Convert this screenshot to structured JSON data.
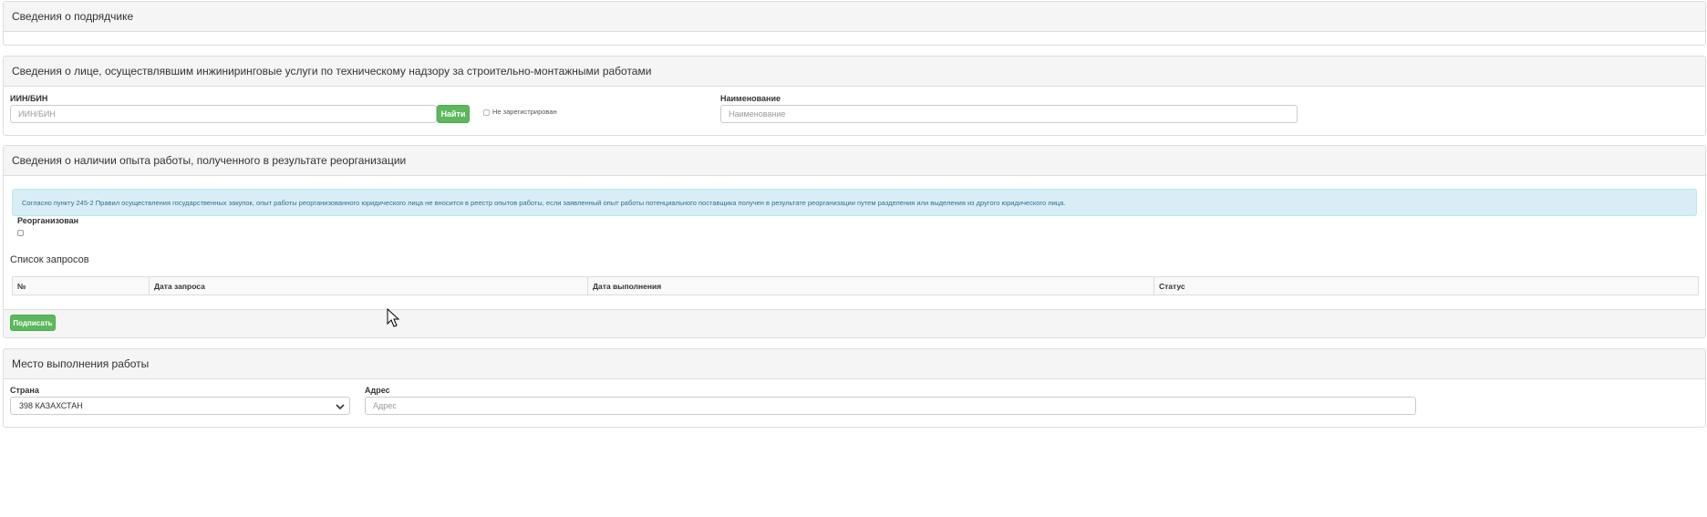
{
  "contractor": {
    "title": "Сведения о подрядчике"
  },
  "engineering": {
    "title": "Сведения о лице, осуществлявшим инжиниринговые услуги по техническому надзору за строительно-монтажными работами",
    "iin_label": "ИИН/БИН",
    "iin_placeholder": "ИИН/БИН",
    "find_button": "Найти",
    "not_registered_label": "Не зарегистрирован",
    "name_label": "Наименование",
    "name_placeholder": "Наименование"
  },
  "reorganization": {
    "title": "Сведения о наличии опыта работы, полученного в результате реорганизации",
    "info_text": "Согласно пункту 245-2 Правил осуществления государственных закупок, опыт работы реорганизованного юридического лица не вносится в реестр опытов работы, если заявленный опыт работы потенциального поставщика получен в результате реорганизации путем разделения или выделения из другого юридического лица.",
    "reorganized_label": "Реорганизован",
    "requests_title": "Список запросов",
    "columns": [
      "№",
      "Дата запроса",
      "Дата выполнения",
      "Статус"
    ],
    "sign_button": "Подписать"
  },
  "work_place": {
    "title": "Место выполнения работы",
    "country_label": "Страна",
    "country_value": "398 КАЗАХСТАН",
    "address_label": "Адрес",
    "address_placeholder": "Адрес"
  },
  "icons": {
    "dropdown": "chevron-down-icon",
    "cursor": "mouse-cursor-icon"
  },
  "colors": {
    "success": "#5cb85c",
    "info_bg": "#d9edf7",
    "info_text": "#31708f",
    "heading_bg": "#f5f5f5"
  }
}
